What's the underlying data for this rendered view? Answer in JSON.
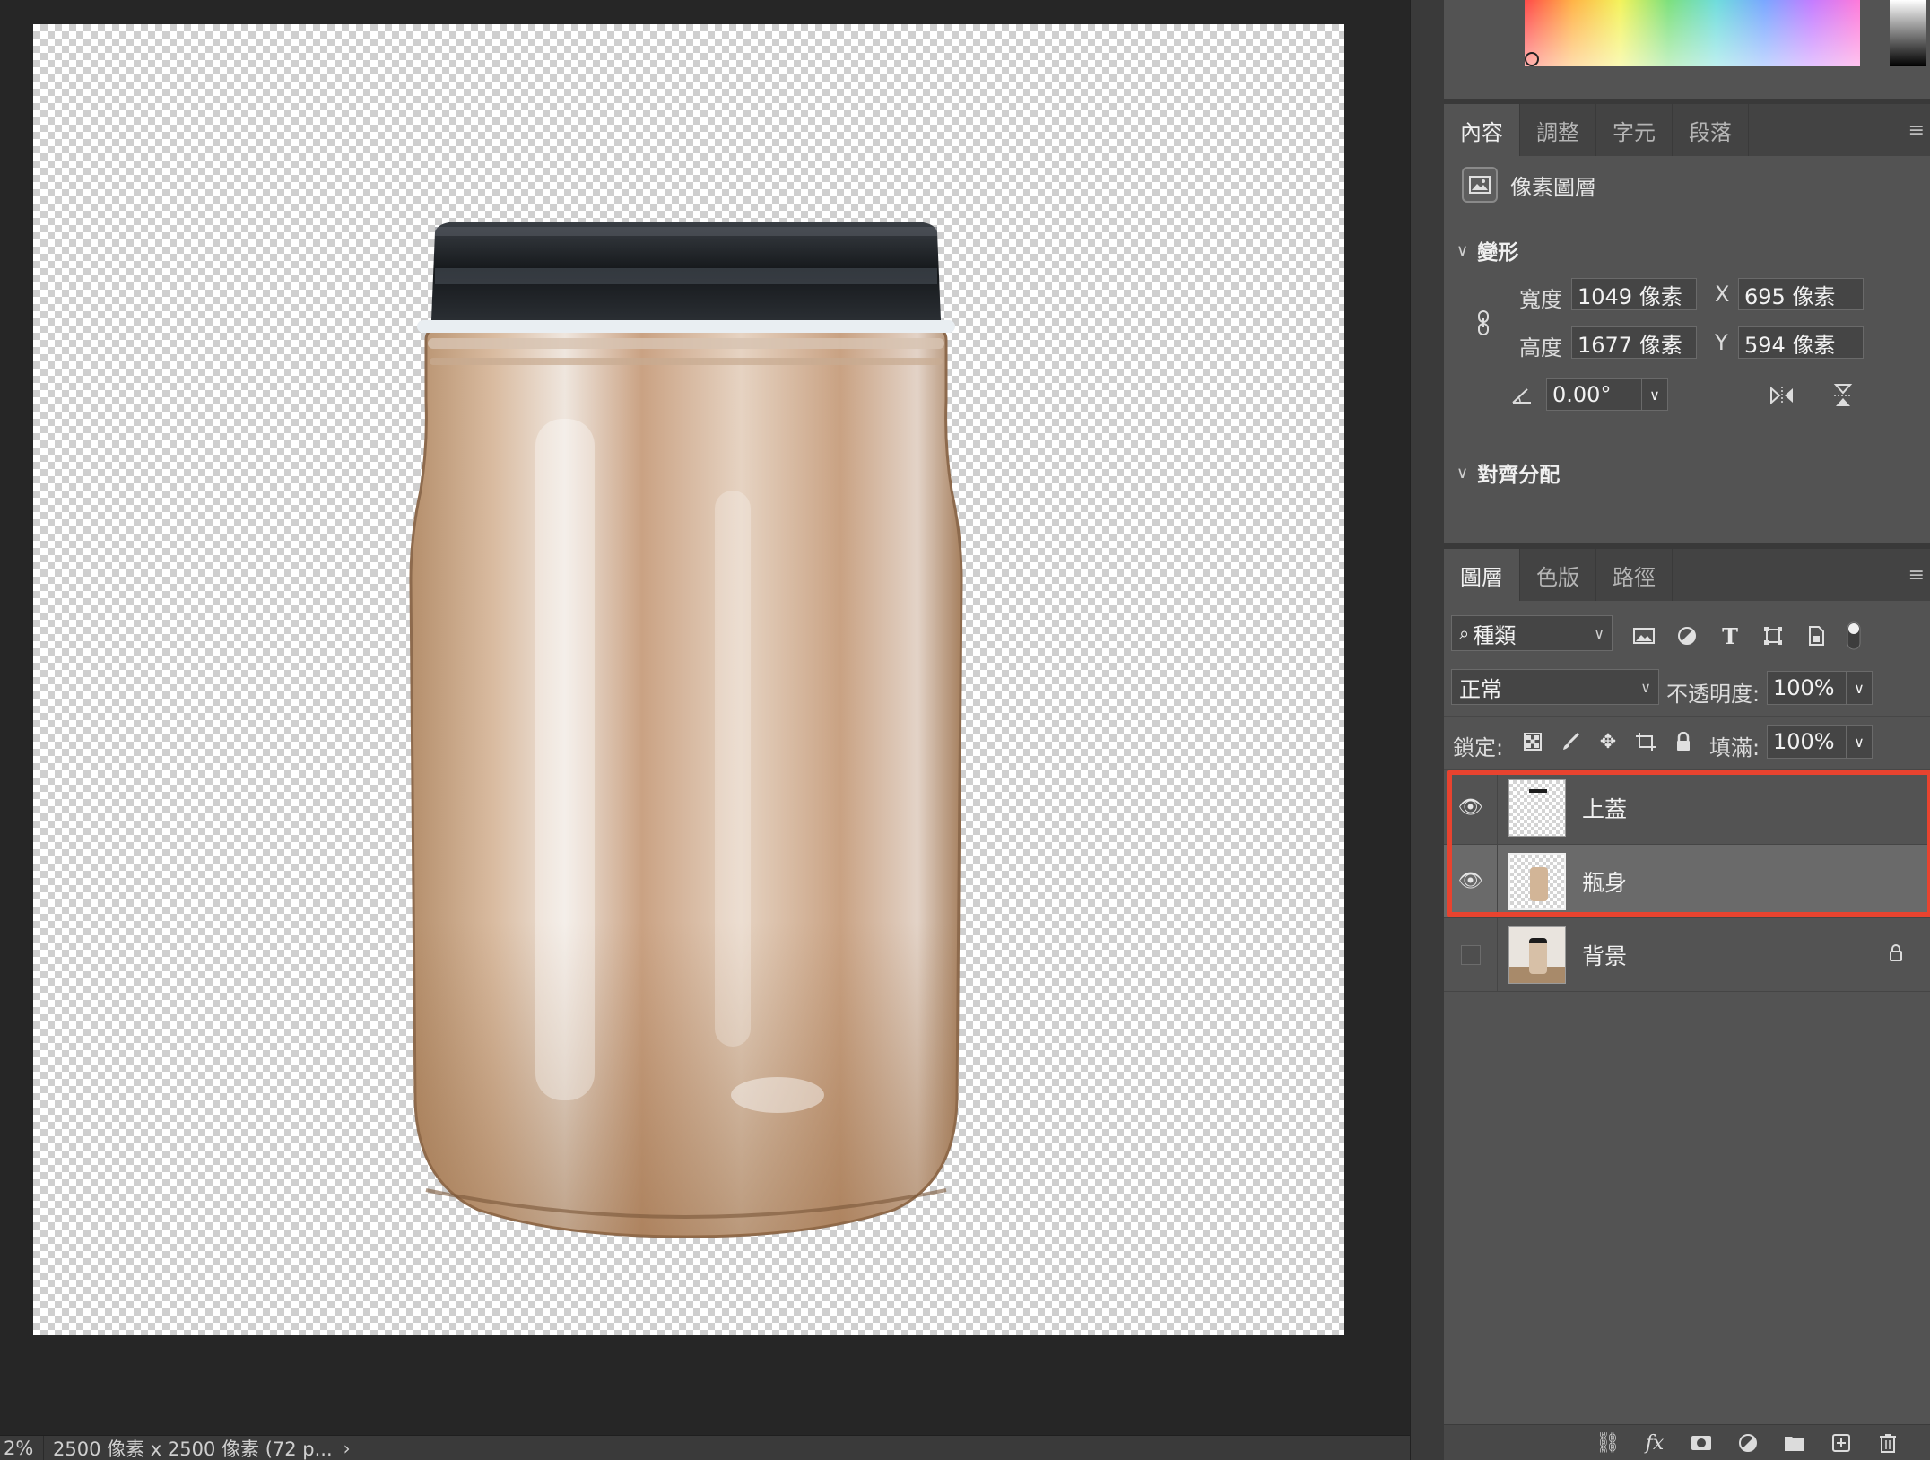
{
  "status_bar": {
    "zoom": "2%",
    "document_info": "2500 像素 x 2500 像素 (72 p...",
    "more_arrow": "›"
  },
  "properties_panel": {
    "tabs": [
      {
        "label": "內容",
        "active": true
      },
      {
        "label": "調整",
        "active": false
      },
      {
        "label": "字元",
        "active": false
      },
      {
        "label": "段落",
        "active": false
      }
    ],
    "menu_icon": "≡",
    "layer_kind": "像素圖層",
    "transform": {
      "section_title": "變形",
      "width_label": "寬度",
      "width_value": "1049 像素",
      "height_label": "高度",
      "height_value": "1677 像素",
      "x_label": "X",
      "x_value": "695 像素",
      "y_label": "Y",
      "y_value": "594 像素",
      "angle_value": "0.00°"
    },
    "align_section_title": "對齊分配"
  },
  "layers_panel": {
    "tabs": [
      {
        "label": "圖層",
        "active": true
      },
      {
        "label": "色版",
        "active": false
      },
      {
        "label": "路徑",
        "active": false
      }
    ],
    "menu_icon": "≡",
    "filter_kind": "種類",
    "blend_mode": "正常",
    "opacity_label": "不透明度:",
    "opacity_value": "100%",
    "lock_label": "鎖定:",
    "fill_label": "填滿:",
    "fill_value": "100%",
    "layers": [
      {
        "name": "上蓋",
        "visible": true,
        "selected": false,
        "locked": false
      },
      {
        "name": "瓶身",
        "visible": true,
        "selected": true,
        "locked": false
      },
      {
        "name": "背景",
        "visible": false,
        "selected": false,
        "locked": true
      }
    ]
  },
  "colors": {
    "highlight_border": "#e8432f",
    "panel_bg": "#535353",
    "canvas_bg": "#262626"
  },
  "icons": {
    "link": "link-icon",
    "fx": "fx-icon",
    "mask": "mask-icon",
    "adjustment": "adjustment-icon",
    "folder": "folder-icon",
    "new_layer": "new-layer-icon",
    "trash": "trash-icon"
  }
}
